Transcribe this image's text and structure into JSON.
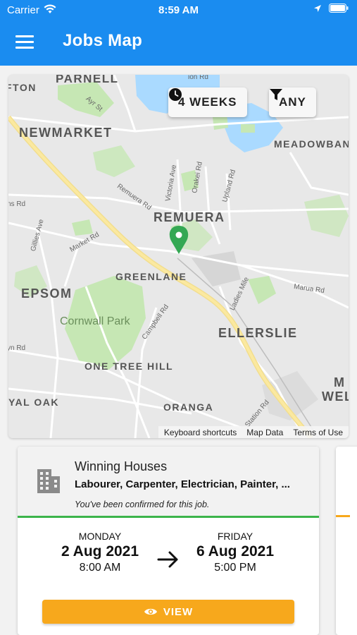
{
  "status_bar": {
    "carrier": "Carrier",
    "time": "8:59 AM"
  },
  "header": {
    "title": "Jobs Map",
    "menu_icon": "hamburger-icon"
  },
  "filters": {
    "period_label": "4 WEEKS",
    "period_icon": "clock-icon",
    "filter_label": "ANY",
    "filter_icon": "filter-icon"
  },
  "map": {
    "labels": {
      "parnell": "PARNELL",
      "ton": "FTON",
      "newmarket": "NEWMARKET",
      "meadowbank": "MEADOWBANK",
      "remuera": "REMUERA",
      "epsom": "EPSOM",
      "greenlane": "GREENLANE",
      "cornwall_park": "Cornwall Park",
      "ellerslie": "ELLERSLIE",
      "one_tree_hill": "ONE TREE HILL",
      "yal_oak": "YAL OAK",
      "oranga": "ORANGA",
      "wel": "WEL",
      "m": "M"
    },
    "streets": {
      "ayr_st": "Ayr St",
      "remuera_rd": "Remuera Rd",
      "victoria_ave": "Victoria Ave",
      "orakei_rd": "Orakei Rd",
      "upland_rd": "Upland Rd",
      "market_rd": "Market Rd",
      "gillies_ave": "Gillies Ave",
      "campbell_rd": "Campbell Rd",
      "ladies_mile": "Ladies Mile",
      "marua_rd": "Marua Rd",
      "station_rd": "Station Rd",
      "ns_rd": "ns Rd",
      "yn_rd": "yn Rd",
      "ion_rd": "ion Rd"
    },
    "pin_color": "#34a853",
    "attribution": {
      "shortcuts": "Keyboard shortcuts",
      "map_data": "Map Data",
      "terms": "Terms of Use"
    }
  },
  "job": {
    "company": "Winning Houses",
    "trades": "Labourer, Carpenter, Electrician, Painter, ...",
    "status_message": "You've been confirmed for this job.",
    "status_color": "#3cb44b",
    "start": {
      "day": "MONDAY",
      "date": "2 Aug 2021",
      "time": "8:00 AM"
    },
    "end": {
      "day": "FRIDAY",
      "date": "6 Aug 2021",
      "time": "5:00 PM"
    },
    "view_label": "VIEW"
  },
  "colors": {
    "brand": "#1a8cf0",
    "accent": "#f7a81c"
  }
}
